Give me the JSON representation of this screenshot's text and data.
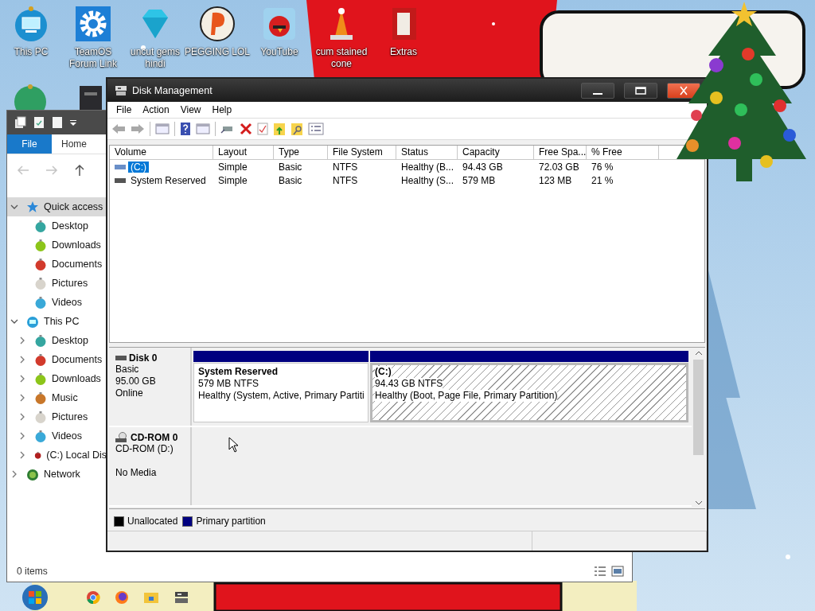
{
  "desktop_icons": [
    {
      "lines": [
        "This PC"
      ],
      "kind": "pc"
    },
    {
      "lines": [
        "TeamOS",
        "Forum Link"
      ],
      "kind": "gear"
    },
    {
      "lines": [
        "uncut gems",
        "hindi"
      ],
      "kind": "gem"
    },
    {
      "lines": [
        "PEGGING LOL"
      ],
      "kind": "letter-badge"
    },
    {
      "lines": [
        "YouTube"
      ],
      "kind": "bird"
    },
    {
      "lines": [
        "cum stained",
        "cone"
      ],
      "kind": "cone"
    },
    {
      "lines": [
        "Extras"
      ],
      "kind": "folder"
    }
  ],
  "explorer": {
    "tabs": [
      {
        "label": "File",
        "selected": true
      },
      {
        "label": "Home",
        "selected": false
      }
    ],
    "nav": [
      {
        "label": "Quick access",
        "kind": "star",
        "expanded": true,
        "selected": true,
        "children": [
          {
            "label": "Desktop",
            "color": "#35a6a0"
          },
          {
            "label": "Downloads",
            "color": "#8cc51a"
          },
          {
            "label": "Documents",
            "color": "#d23a2c"
          },
          {
            "label": "Pictures",
            "color": "#d8d4cc"
          },
          {
            "label": "Videos",
            "color": "#3aa9d8"
          }
        ]
      },
      {
        "label": "This PC",
        "kind": "pc",
        "expanded": true,
        "selected": false,
        "children": [
          {
            "label": "Desktop",
            "color": "#35a6a0",
            "expanded": false
          },
          {
            "label": "Documents",
            "color": "#d23a2c",
            "expanded": false
          },
          {
            "label": "Downloads",
            "color": "#8cc51a",
            "expanded": false
          },
          {
            "label": "Music",
            "color": "#c8772a",
            "expanded": false
          },
          {
            "label": "Pictures",
            "color": "#d8d4cc",
            "expanded": false
          },
          {
            "label": "Videos",
            "color": "#3aa9d8",
            "expanded": false
          },
          {
            "label": "(C:) Local Dis",
            "color": "#b02020",
            "expanded": false
          }
        ]
      },
      {
        "label": "Network",
        "kind": "network",
        "expanded": false,
        "selected": false
      }
    ],
    "status": "0 items"
  },
  "disk_management": {
    "title": "Disk Management",
    "menu": [
      "File",
      "Action",
      "View",
      "Help"
    ],
    "columns": [
      "Volume",
      "Layout",
      "Type",
      "File System",
      "Status",
      "Capacity",
      "Free Spa...",
      "% Free"
    ],
    "rows": [
      {
        "selected": true,
        "cells": [
          "(C:)",
          "Simple",
          "Basic",
          "NTFS",
          "Healthy (B...",
          "94.43 GB",
          "72.03 GB",
          "76 %"
        ]
      },
      {
        "selected": false,
        "cells": [
          "System Reserved",
          "Simple",
          "Basic",
          "NTFS",
          "Healthy (S...",
          "579 MB",
          "123 MB",
          "21 %"
        ]
      }
    ],
    "disks": [
      {
        "name": "Disk 0",
        "kind": "hdd",
        "lines": [
          "Basic",
          "95.00 GB",
          "Online"
        ],
        "partitions": [
          {
            "title": "System Reserved",
            "size": "579 MB NTFS",
            "status": "Healthy (System, Active, Primary Partiti",
            "selected": false
          },
          {
            "title": "(C:)",
            "size": "94.43 GB NTFS",
            "status": "Healthy (Boot, Page File, Primary Partition)",
            "selected": true
          }
        ]
      },
      {
        "name": "CD-ROM 0",
        "kind": "cdrom",
        "lines": [
          "CD-ROM (D:)"
        ],
        "note": "No Media"
      }
    ],
    "legend": [
      {
        "label": "Unallocated",
        "color": "#000000"
      },
      {
        "label": "Primary partition",
        "color": "#000080"
      }
    ]
  }
}
